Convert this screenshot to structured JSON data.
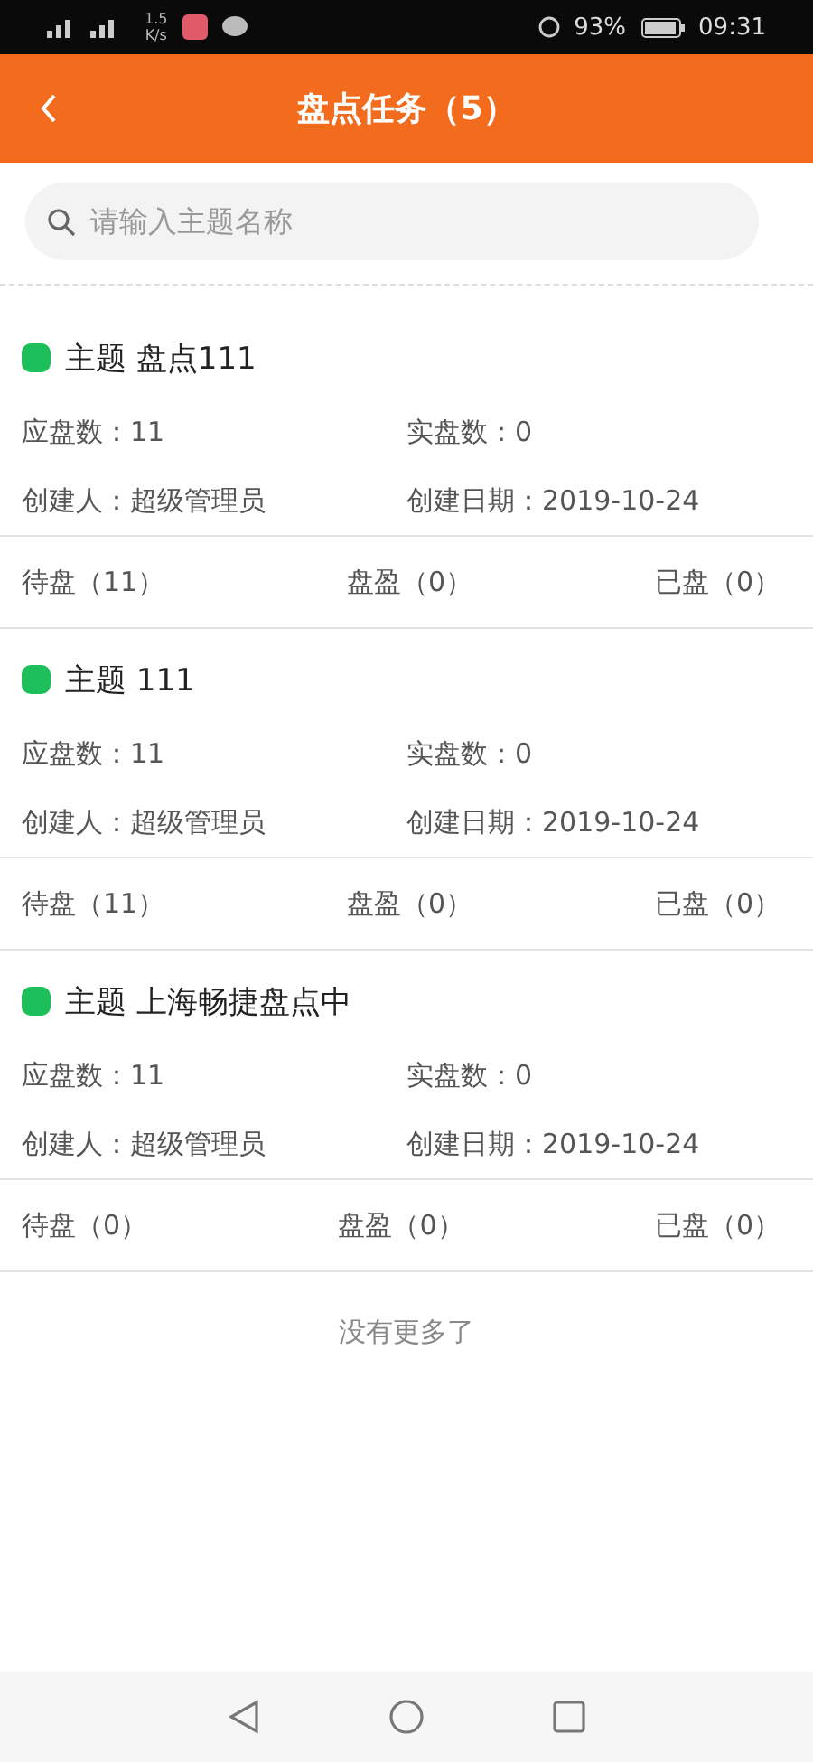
{
  "status_bar": {
    "speed": "1.5",
    "speed_unit": "K/s",
    "battery": "93%",
    "time": "09:31"
  },
  "header": {
    "title": "盘点任务（5）"
  },
  "search": {
    "placeholder": "请输入主题名称"
  },
  "tasks": [
    {
      "color": "#1dbf5a",
      "title": "主题 盘点111",
      "expected": "应盘数：11",
      "actual": "实盘数：0",
      "creator": "创建人：超级管理员",
      "date": "创建日期：2019-10-24",
      "tabs": [
        "待盘（11）",
        "盘盈（0）",
        "已盘（0）"
      ]
    },
    {
      "color": "#1dbf5a",
      "title": "主题 111",
      "expected": "应盘数：11",
      "actual": "实盘数：0",
      "creator": "创建人：超级管理员",
      "date": "创建日期：2019-10-24",
      "tabs": [
        "待盘（11）",
        "盘盈（0）",
        "已盘（0）"
      ]
    },
    {
      "color": "#1dbf5a",
      "title": "主题 上海畅捷盘点中",
      "expected": "应盘数：11",
      "actual": "实盘数：0",
      "creator": "创建人：超级管理员",
      "date": "创建日期：2019-10-24",
      "tabs": [
        "待盘（0）",
        "盘盈（0）",
        "已盘（0）"
      ]
    }
  ],
  "footer": "没有更多了"
}
